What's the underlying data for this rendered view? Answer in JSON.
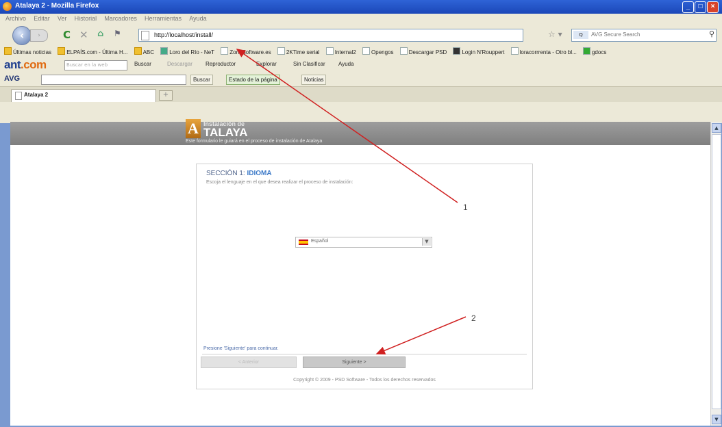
{
  "window": {
    "title": "Atalaya 2 - Mozilla Firefox",
    "min_label": "_",
    "max_label": "□",
    "close_label": "×"
  },
  "menu": [
    "Archivo",
    "Editar",
    "Ver",
    "Historial",
    "Marcadores",
    "Herramientas",
    "Ayuda"
  ],
  "nav": {
    "url": "http://localhost/install/",
    "search_placeholder": "AVG Secure Search",
    "search_engine": "Q"
  },
  "bookmarks": [
    "Últimas noticias",
    "ELPAÍS.com - Última H...",
    "ABC",
    "Loro del Río - NeT",
    "ZoneSoftware.es",
    "2KTime serial",
    "Internal2",
    "Opengos",
    "Descargar PSD",
    "Login N'Rouppert",
    "loracorrrenta - Otro bl...",
    "gdocs"
  ],
  "ant": {
    "logo_a": "ant",
    "logo_b": ".com",
    "search_placeholder": "Buscar en la web",
    "buttons": [
      "Buscar",
      "Descargar",
      "Reproductor",
      "Explorar",
      "Sin Clasificar",
      "Ayuda"
    ]
  },
  "avg": {
    "logo": "AVG",
    "buttons": [
      "Buscar",
      "Estado de la página",
      "Noticias"
    ]
  },
  "tab": {
    "label": "Atalaya 2",
    "new_tab": "+"
  },
  "page": {
    "logo_letter": "A",
    "logo_sub": "Instalación de",
    "logo_main": "TALAYA",
    "tagline": "Este formulario le guiará en el proceso de instalación de Atalaya",
    "section_prefix": "SECCIÓN 1:",
    "section_name": "IDIOMA",
    "section_desc": "Escoja el lenguaje en el que desea realizar el proceso de instalación:",
    "language": "Español",
    "continue_text": "Presione 'Siguiente' para continuar.",
    "prev_label": "< Anterior",
    "next_label": "Siguiente >",
    "copyright": "Copyright © 2009 - PSD Software - Todos los derechos reservados"
  },
  "annotations": {
    "one": "1",
    "two": "2"
  },
  "colors": {
    "titlebar": "#2f63d6",
    "chrome": "#ece9d8",
    "header_band": "#8e8e8e",
    "arrow": "#d02020",
    "section_accent": "#3d7ac8"
  }
}
